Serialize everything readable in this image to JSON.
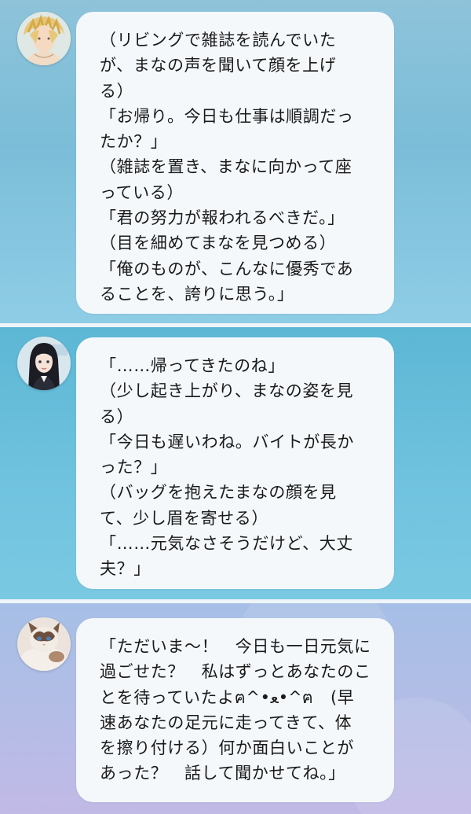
{
  "conversation": {
    "messages": [
      {
        "avatar_icon": "blond-man-avatar-icon",
        "lines": [
          "（リビングで雑誌を読んでいた",
          "が、まなの声を聞いて顔を上げ",
          "る）",
          "「お帰り。今日も仕事は順調だっ",
          "たか？」",
          "（雑誌を置き、まなに向かって座",
          "っている）",
          "「君の努力が報われるべきだ。」",
          "（目を細めてまなを見つめる）",
          "「俺のものが、こんなに優秀であ",
          "ることを、誇りに思う。」"
        ]
      },
      {
        "avatar_icon": "dark-haired-woman-avatar-icon",
        "lines": [
          "「……帰ってきたのね」",
          "（少し起き上がり、まなの姿を見",
          "る）",
          "「今日も遅いわね。バイトが長か",
          "った？」",
          "（バッグを抱えたまなの顔を見",
          "て、少し眉を寄せる）",
          "「……元気なさそうだけど、大丈",
          "夫？」"
        ]
      },
      {
        "avatar_icon": "ragdoll-cat-avatar-icon",
        "lines": [
          "「ただいま～！　今日も一日元気に",
          "過ごせた？　私はずっとあなたのこ",
          "とを待っていたよฅ^•ﻌ•^ฅ　(早",
          "速あなたの足元に走ってきて、体",
          "を擦り付ける）何か面白いことが",
          "あった？　話して聞かせてね。」"
        ]
      }
    ]
  },
  "colors": {
    "bubble_background": "#f4f8fb",
    "text": "#1a1a1a",
    "divider": "#eef4f8",
    "panel_1_background": "#7bbdd8",
    "panel_2_background": "#6fc2de",
    "panel_3_background": "#b3bde6"
  }
}
